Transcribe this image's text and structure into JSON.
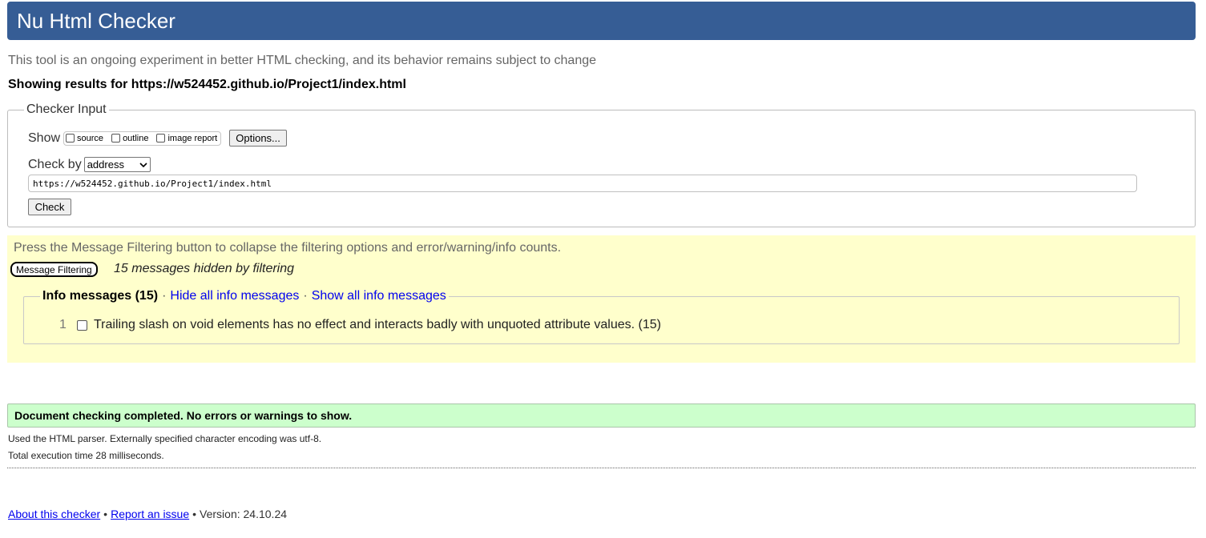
{
  "header": {
    "title": "Nu Html Checker"
  },
  "tagline": "This tool is an ongoing experiment in better HTML checking, and its behavior remains subject to change",
  "results": {
    "heading": "Showing results for https://w524452.github.io/Project1/index.html"
  },
  "checker_input": {
    "legend": "Checker Input",
    "show_label": "Show",
    "show_options": [
      "source",
      "outline",
      "image report"
    ],
    "options_button": "Options...",
    "check_by_label": "Check by",
    "check_by_value": "address",
    "url_value": "https://w524452.github.io/Project1/index.html",
    "check_button": "Check"
  },
  "filtering": {
    "hint": "Press the Message Filtering button to collapse the filtering options and error/warning/info counts.",
    "button": "Message Filtering",
    "hidden_count": "15 messages hidden by filtering",
    "info_title": "Info messages (15)",
    "separator": "·",
    "hide_all": "Hide all info messages",
    "show_all": "Show all info messages",
    "messages": [
      {
        "number": "1",
        "text": "Trailing slash on void elements has no effect and interacts badly with unquoted attribute values. (15)"
      }
    ]
  },
  "summary": {
    "status": "Document checking completed. No errors or warnings to show.",
    "parser": "Used the HTML parser. Externally specified character encoding was utf-8.",
    "time": "Total execution time 28 milliseconds."
  },
  "footer": {
    "about": "About this checker",
    "report": "Report an issue",
    "bullet": "•",
    "version": "Version: 24.10.24"
  },
  "colors": {
    "header_bg": "#365d95",
    "filter_bg": "#ffffcc",
    "success_bg": "#ccffcc",
    "link": "#0000ee"
  }
}
